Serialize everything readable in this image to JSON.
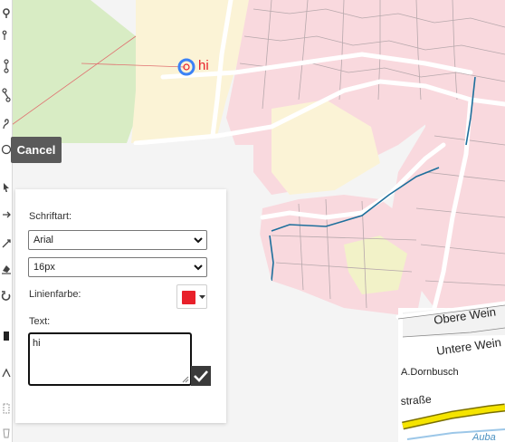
{
  "map": {
    "annotation_text": "hi",
    "street_labels": [
      "Obere Wein",
      "Untere Wein",
      "A.Dornbusch",
      "straße",
      "Auba"
    ]
  },
  "toolbar": {
    "cancel_label": "Cancel",
    "tools": [
      "draw-point-icon",
      "draw-line-icon",
      "draw-polyline-icon",
      "draw-path-icon",
      "draw-freehand-icon",
      "draw-circle-icon",
      "select-icon",
      "move-icon",
      "rotate-icon",
      "erase-icon",
      "undo-icon",
      "snap-icon",
      "measure-icon",
      "paste-icon",
      "delete-icon"
    ]
  },
  "text_panel": {
    "font_label": "Schriftart:",
    "font_value": "Arial",
    "size_value": "16px",
    "line_color_label": "Linienfarbe:",
    "line_color": "#e8202a",
    "text_label": "Text:",
    "text_value": "hi"
  }
}
